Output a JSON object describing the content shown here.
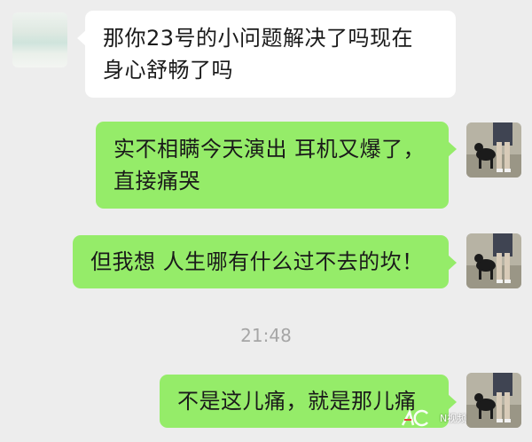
{
  "messages": [
    {
      "direction": "incoming",
      "text_line1": "那你23号的小问题解决了吗现在",
      "text_line2": "身心舒畅了吗"
    },
    {
      "direction": "outgoing",
      "text_line1": "实不相瞒今天演出 耳机又爆了，",
      "text_line2": "直接痛哭"
    },
    {
      "direction": "outgoing",
      "text_line1": "但我想 人生哪有什么过不去的坎！"
    },
    {
      "direction": "outgoing",
      "text_line1": "不是这儿痛，就是那儿痛"
    }
  ],
  "timestamp": "21:48",
  "watermark": {
    "text": "N视频"
  },
  "colors": {
    "background": "#ededed",
    "incoming_bubble": "#ffffff",
    "outgoing_bubble": "#95ec69",
    "timestamp": "#a6a6a6"
  },
  "icons": {
    "left_avatar": "blurred-avatar-icon",
    "right_avatar": "person-with-dog-avatar-icon",
    "watermark_logo": "nc-logo-icon"
  }
}
